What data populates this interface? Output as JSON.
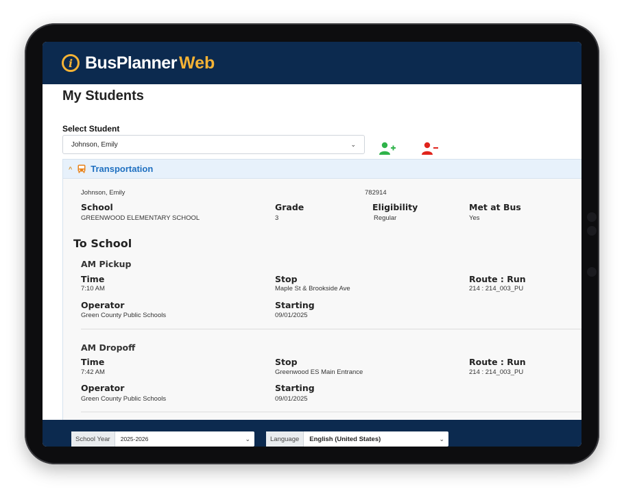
{
  "brand": {
    "name_part1": "BusPlanner",
    "name_part2": "Web",
    "mark": "i"
  },
  "page": {
    "title": "My Students"
  },
  "student_select": {
    "label": "Select Student",
    "value": "Johnson, Emily"
  },
  "panel": {
    "title": "Transportation",
    "student_name": "Johnson, Emily",
    "student_id": "782914",
    "fields": [
      {
        "label": "School",
        "value": "GREENWOOD ELEMENTARY SCHOOL"
      },
      {
        "label": "Grade",
        "value": "3"
      },
      {
        "label": "Eligibility",
        "value": "Regular"
      },
      {
        "label": "Met at Bus",
        "value": "Yes"
      }
    ],
    "section_title": "To School",
    "trips": [
      {
        "name": "AM Pickup",
        "time_label": "Time",
        "time": "7:10 AM",
        "stop_label": "Stop",
        "stop": "Maple St & Brookside Ave",
        "route_label": "Route : Run",
        "route": "214 : 214_003_PU",
        "operator_label": "Operator",
        "operator": "Green County Public Schools",
        "starting_label": "Starting",
        "starting": "09/01/2025"
      },
      {
        "name": "AM Dropoff",
        "time_label": "Time",
        "time": "7:42 AM",
        "stop_label": "Stop",
        "stop": "Greenwood ES Main Entrance",
        "route_label": "Route : Run",
        "route": "214 : 214_003_PU",
        "operator_label": "Operator",
        "operator": "Green County Public Schools",
        "starting_label": "Starting",
        "starting": "09/01/2025"
      }
    ]
  },
  "footer": {
    "school_year_label": "School Year",
    "school_year": "2025-2026",
    "language_label": "Language",
    "language": "English (United States)"
  },
  "icons": {
    "logo": "logo-mark-icon",
    "add_student": "add-user-icon",
    "remove_student": "remove-user-icon",
    "bus": "bus-icon",
    "collapse": "chevron-up-icon",
    "dropdown": "chevron-down-icon"
  },
  "colors": {
    "header_bg": "#0c2a4f",
    "brand_accent": "#f5b335",
    "panel_title": "#1e6fc0",
    "add_icon": "#2fb34a",
    "remove_icon": "#e0241c"
  }
}
